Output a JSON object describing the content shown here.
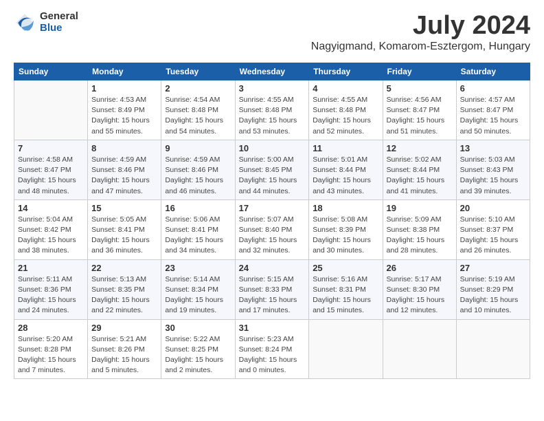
{
  "logo": {
    "general": "General",
    "blue": "Blue"
  },
  "title": "July 2024",
  "location": "Nagyigmand, Komarom-Esztergom, Hungary",
  "days_header": [
    "Sunday",
    "Monday",
    "Tuesday",
    "Wednesday",
    "Thursday",
    "Friday",
    "Saturday"
  ],
  "weeks": [
    [
      {
        "day": "",
        "info": ""
      },
      {
        "day": "1",
        "info": "Sunrise: 4:53 AM\nSunset: 8:49 PM\nDaylight: 15 hours\nand 55 minutes."
      },
      {
        "day": "2",
        "info": "Sunrise: 4:54 AM\nSunset: 8:48 PM\nDaylight: 15 hours\nand 54 minutes."
      },
      {
        "day": "3",
        "info": "Sunrise: 4:55 AM\nSunset: 8:48 PM\nDaylight: 15 hours\nand 53 minutes."
      },
      {
        "day": "4",
        "info": "Sunrise: 4:55 AM\nSunset: 8:48 PM\nDaylight: 15 hours\nand 52 minutes."
      },
      {
        "day": "5",
        "info": "Sunrise: 4:56 AM\nSunset: 8:47 PM\nDaylight: 15 hours\nand 51 minutes."
      },
      {
        "day": "6",
        "info": "Sunrise: 4:57 AM\nSunset: 8:47 PM\nDaylight: 15 hours\nand 50 minutes."
      }
    ],
    [
      {
        "day": "7",
        "info": "Sunrise: 4:58 AM\nSunset: 8:47 PM\nDaylight: 15 hours\nand 48 minutes."
      },
      {
        "day": "8",
        "info": "Sunrise: 4:59 AM\nSunset: 8:46 PM\nDaylight: 15 hours\nand 47 minutes."
      },
      {
        "day": "9",
        "info": "Sunrise: 4:59 AM\nSunset: 8:46 PM\nDaylight: 15 hours\nand 46 minutes."
      },
      {
        "day": "10",
        "info": "Sunrise: 5:00 AM\nSunset: 8:45 PM\nDaylight: 15 hours\nand 44 minutes."
      },
      {
        "day": "11",
        "info": "Sunrise: 5:01 AM\nSunset: 8:44 PM\nDaylight: 15 hours\nand 43 minutes."
      },
      {
        "day": "12",
        "info": "Sunrise: 5:02 AM\nSunset: 8:44 PM\nDaylight: 15 hours\nand 41 minutes."
      },
      {
        "day": "13",
        "info": "Sunrise: 5:03 AM\nSunset: 8:43 PM\nDaylight: 15 hours\nand 39 minutes."
      }
    ],
    [
      {
        "day": "14",
        "info": "Sunrise: 5:04 AM\nSunset: 8:42 PM\nDaylight: 15 hours\nand 38 minutes."
      },
      {
        "day": "15",
        "info": "Sunrise: 5:05 AM\nSunset: 8:41 PM\nDaylight: 15 hours\nand 36 minutes."
      },
      {
        "day": "16",
        "info": "Sunrise: 5:06 AM\nSunset: 8:41 PM\nDaylight: 15 hours\nand 34 minutes."
      },
      {
        "day": "17",
        "info": "Sunrise: 5:07 AM\nSunset: 8:40 PM\nDaylight: 15 hours\nand 32 minutes."
      },
      {
        "day": "18",
        "info": "Sunrise: 5:08 AM\nSunset: 8:39 PM\nDaylight: 15 hours\nand 30 minutes."
      },
      {
        "day": "19",
        "info": "Sunrise: 5:09 AM\nSunset: 8:38 PM\nDaylight: 15 hours\nand 28 minutes."
      },
      {
        "day": "20",
        "info": "Sunrise: 5:10 AM\nSunset: 8:37 PM\nDaylight: 15 hours\nand 26 minutes."
      }
    ],
    [
      {
        "day": "21",
        "info": "Sunrise: 5:11 AM\nSunset: 8:36 PM\nDaylight: 15 hours\nand 24 minutes."
      },
      {
        "day": "22",
        "info": "Sunrise: 5:13 AM\nSunset: 8:35 PM\nDaylight: 15 hours\nand 22 minutes."
      },
      {
        "day": "23",
        "info": "Sunrise: 5:14 AM\nSunset: 8:34 PM\nDaylight: 15 hours\nand 19 minutes."
      },
      {
        "day": "24",
        "info": "Sunrise: 5:15 AM\nSunset: 8:33 PM\nDaylight: 15 hours\nand 17 minutes."
      },
      {
        "day": "25",
        "info": "Sunrise: 5:16 AM\nSunset: 8:31 PM\nDaylight: 15 hours\nand 15 minutes."
      },
      {
        "day": "26",
        "info": "Sunrise: 5:17 AM\nSunset: 8:30 PM\nDaylight: 15 hours\nand 12 minutes."
      },
      {
        "day": "27",
        "info": "Sunrise: 5:19 AM\nSunset: 8:29 PM\nDaylight: 15 hours\nand 10 minutes."
      }
    ],
    [
      {
        "day": "28",
        "info": "Sunrise: 5:20 AM\nSunset: 8:28 PM\nDaylight: 15 hours\nand 7 minutes."
      },
      {
        "day": "29",
        "info": "Sunrise: 5:21 AM\nSunset: 8:26 PM\nDaylight: 15 hours\nand 5 minutes."
      },
      {
        "day": "30",
        "info": "Sunrise: 5:22 AM\nSunset: 8:25 PM\nDaylight: 15 hours\nand 2 minutes."
      },
      {
        "day": "31",
        "info": "Sunrise: 5:23 AM\nSunset: 8:24 PM\nDaylight: 15 hours\nand 0 minutes."
      },
      {
        "day": "",
        "info": ""
      },
      {
        "day": "",
        "info": ""
      },
      {
        "day": "",
        "info": ""
      }
    ]
  ]
}
